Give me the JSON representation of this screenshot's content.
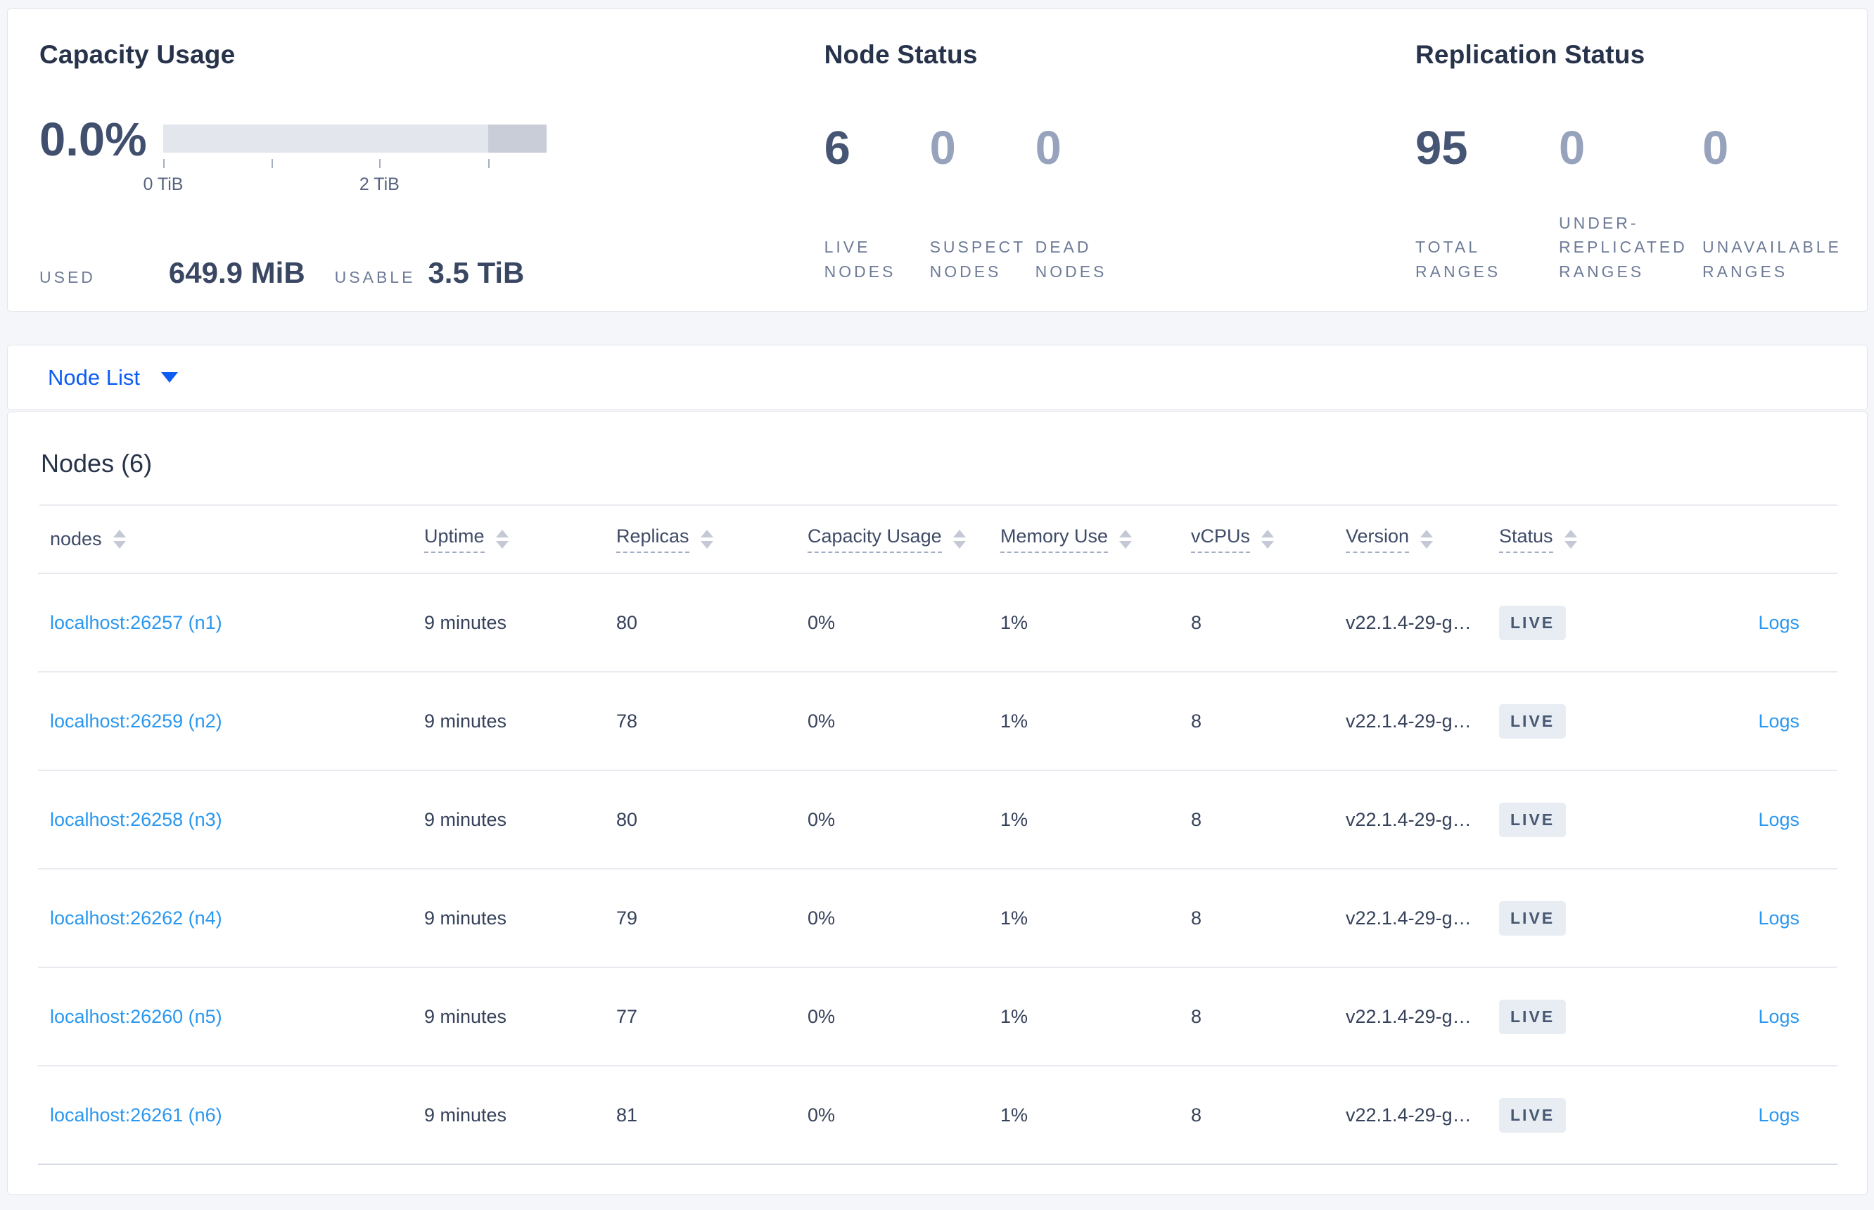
{
  "colors": {
    "link_blue": "#2a97f0",
    "selector_blue": "#0d5cf3",
    "badge_bg": "#e8ecf3",
    "badge_text": "#475872",
    "bar_light": "#e3e6ed",
    "bar_dark": "#c9cdd8",
    "page_bg": "#f4f6fa"
  },
  "overview": {
    "capacity": {
      "title": "Capacity Usage",
      "percent": "0.0%",
      "used_label": "USED",
      "used_value": "649.9 MiB",
      "usable_label": "USABLE",
      "usable_value": "3.5 TiB",
      "bar": {
        "used_fraction": 0.0,
        "dark_segment_start": 0.848,
        "ticks": [
          {
            "pos": 0.0,
            "label": "0 TiB"
          },
          {
            "pos": 0.282,
            "label": ""
          },
          {
            "pos": 0.564,
            "label": "2 TiB"
          },
          {
            "pos": 0.848,
            "label": ""
          }
        ]
      }
    },
    "node_status": {
      "title": "Node Status",
      "stats": [
        {
          "value": "6",
          "label": "LIVE NODES",
          "emphasis": true
        },
        {
          "value": "0",
          "label": "SUSPECT NODES",
          "emphasis": false
        },
        {
          "value": "0",
          "label": "DEAD NODES",
          "emphasis": false
        }
      ]
    },
    "replication_status": {
      "title": "Replication Status",
      "stats": [
        {
          "value": "95",
          "label": "TOTAL RANGES",
          "emphasis": true
        },
        {
          "value": "0",
          "label": "UNDER-REPLICATED RANGES",
          "emphasis": false
        },
        {
          "value": "0",
          "label": "UNAVAILABLE RANGES",
          "emphasis": false
        }
      ]
    }
  },
  "view_selector": {
    "label": "Node List"
  },
  "nodes_section": {
    "title": "Nodes (6)",
    "logs_label": "Logs",
    "columns": [
      {
        "label": "nodes",
        "tip": false
      },
      {
        "label": "Uptime",
        "tip": true
      },
      {
        "label": "Replicas",
        "tip": true
      },
      {
        "label": "Capacity Usage",
        "tip": true
      },
      {
        "label": "Memory Use",
        "tip": true
      },
      {
        "label": "vCPUs",
        "tip": true
      },
      {
        "label": "Version",
        "tip": true
      },
      {
        "label": "Status",
        "tip": true
      },
      {
        "label": "",
        "tip": false
      }
    ],
    "rows": [
      {
        "address": "localhost:26257 (n1)",
        "uptime": "9 minutes",
        "replicas": "80",
        "capacity_usage": "0%",
        "memory_use": "1%",
        "vcpus": "8",
        "version": "v22.1.4-29-g…",
        "status": "LIVE"
      },
      {
        "address": "localhost:26259 (n2)",
        "uptime": "9 minutes",
        "replicas": "78",
        "capacity_usage": "0%",
        "memory_use": "1%",
        "vcpus": "8",
        "version": "v22.1.4-29-g…",
        "status": "LIVE"
      },
      {
        "address": "localhost:26258 (n3)",
        "uptime": "9 minutes",
        "replicas": "80",
        "capacity_usage": "0%",
        "memory_use": "1%",
        "vcpus": "8",
        "version": "v22.1.4-29-g…",
        "status": "LIVE"
      },
      {
        "address": "localhost:26262 (n4)",
        "uptime": "9 minutes",
        "replicas": "79",
        "capacity_usage": "0%",
        "memory_use": "1%",
        "vcpus": "8",
        "version": "v22.1.4-29-g…",
        "status": "LIVE"
      },
      {
        "address": "localhost:26260 (n5)",
        "uptime": "9 minutes",
        "replicas": "77",
        "capacity_usage": "0%",
        "memory_use": "1%",
        "vcpus": "8",
        "version": "v22.1.4-29-g…",
        "status": "LIVE"
      },
      {
        "address": "localhost:26261 (n6)",
        "uptime": "9 minutes",
        "replicas": "81",
        "capacity_usage": "0%",
        "memory_use": "1%",
        "vcpus": "8",
        "version": "v22.1.4-29-g…",
        "status": "LIVE"
      }
    ]
  }
}
